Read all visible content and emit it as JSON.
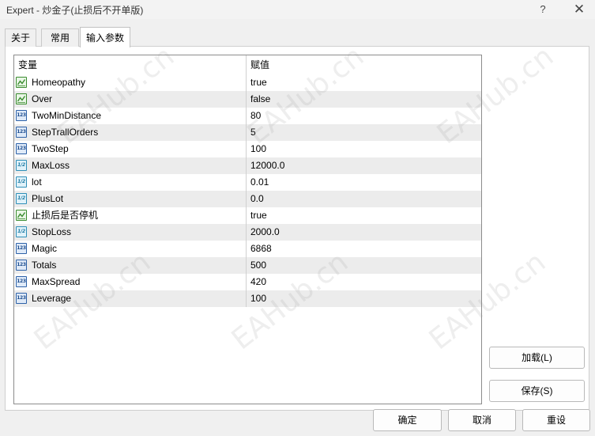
{
  "window": {
    "title": "Expert - 炒金子(止损后不开单版)",
    "help_label": "?",
    "close_label": "✕"
  },
  "tabs": [
    {
      "label": "关于",
      "active": false
    },
    {
      "label": "常用",
      "active": false
    },
    {
      "label": "输入参数",
      "active": true
    }
  ],
  "grid": {
    "columns": [
      "变量",
      "赋值"
    ],
    "rows": [
      {
        "name": "Homeopathy",
        "value": "true",
        "type": "bool-icon"
      },
      {
        "name": "Over",
        "value": "false",
        "type": "bool-icon"
      },
      {
        "name": "TwoMinDistance",
        "value": "80",
        "type": "int-icon"
      },
      {
        "name": "StepTrallOrders",
        "value": "5",
        "type": "int-icon"
      },
      {
        "name": "TwoStep",
        "value": "100",
        "type": "int-icon"
      },
      {
        "name": "MaxLoss",
        "value": "12000.0",
        "type": "double-icon"
      },
      {
        "name": "lot",
        "value": "0.01",
        "type": "double-icon"
      },
      {
        "name": "PlusLot",
        "value": "0.0",
        "type": "double-icon"
      },
      {
        "name": "止损后是否停机",
        "value": "true",
        "type": "bool-icon"
      },
      {
        "name": "StopLoss",
        "value": "2000.0",
        "type": "double-icon"
      },
      {
        "name": "Magic",
        "value": "6868",
        "type": "int-icon"
      },
      {
        "name": "Totals",
        "value": "500",
        "type": "int-icon"
      },
      {
        "name": "MaxSpread",
        "value": "420",
        "type": "int-icon"
      },
      {
        "name": "Leverage",
        "value": "100",
        "type": "int-icon"
      }
    ]
  },
  "icons": {
    "int_text": "123",
    "double_text": "1/2"
  },
  "side_buttons": {
    "load": "加载(L)",
    "save": "保存(S)"
  },
  "footer_buttons": {
    "ok": "确定",
    "cancel": "取消",
    "reset": "重设"
  },
  "watermark": "EAHub.cn",
  "colors": {
    "bool_icon": "#3a8c2f",
    "int_icon": "#2e62a8",
    "double_icon": "#2f8fb8",
    "row_alt": "#ececec"
  }
}
